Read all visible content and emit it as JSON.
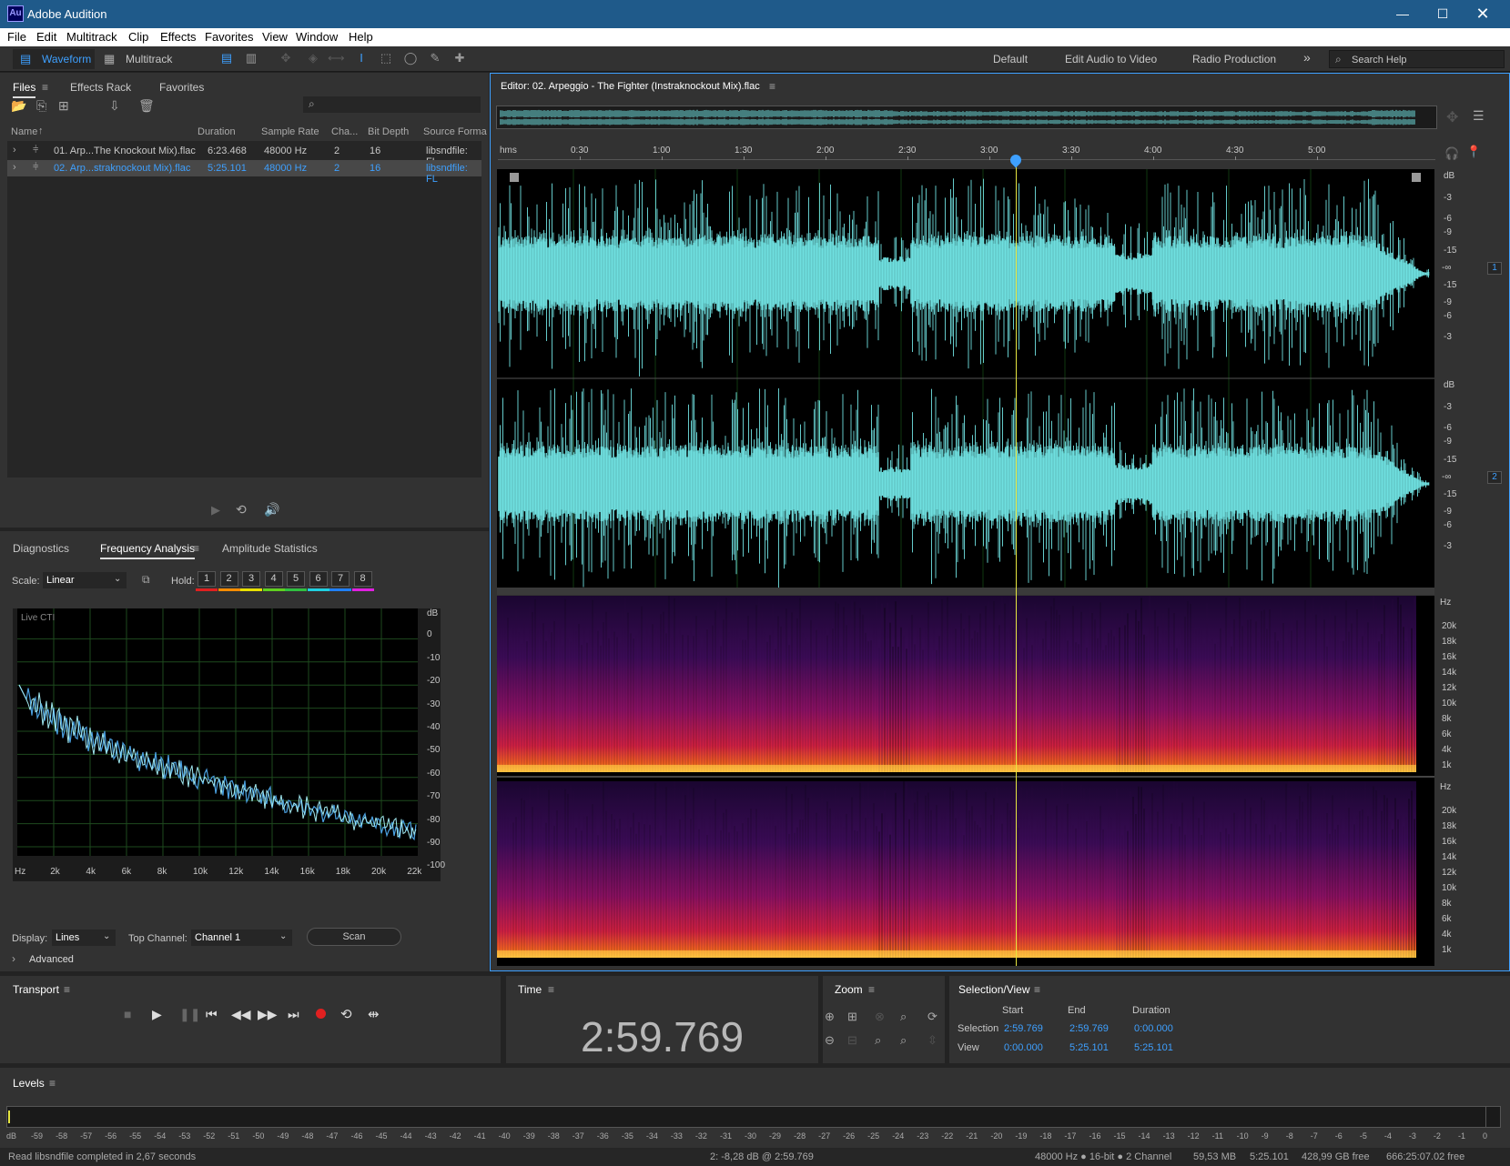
{
  "window": {
    "title": "Adobe Audition",
    "app_icon_text": "Au"
  },
  "menu": [
    "File",
    "Edit",
    "Multitrack",
    "Clip",
    "Effects",
    "Favorites",
    "View",
    "Window",
    "Help"
  ],
  "toolbar": {
    "waveform": "Waveform",
    "multitrack": "Multitrack",
    "workspaces": [
      "Default",
      "Edit Audio to Video",
      "Radio Production"
    ],
    "more": "»",
    "search_placeholder": "Search Help"
  },
  "files_panel": {
    "tabs": [
      "Files",
      "Effects Rack",
      "Favorites"
    ],
    "columns": [
      "Name",
      "Duration",
      "Sample Rate",
      "Cha...",
      "Bit Depth",
      "Source Forma"
    ],
    "rows": [
      {
        "name": "01. Arp...The Knockout Mix).flac",
        "duration": "6:23.468",
        "sample_rate": "48000 Hz",
        "channels": "2",
        "bit_depth": "16",
        "source": "libsndfile: FL"
      },
      {
        "name": "02. Arp...straknockout Mix).flac",
        "duration": "5:25.101",
        "sample_rate": "48000 Hz",
        "channels": "2",
        "bit_depth": "16",
        "source": "libsndfile: FL"
      }
    ]
  },
  "analysis_panel": {
    "tabs": [
      "Diagnostics",
      "Frequency Analysis",
      "Amplitude Statistics"
    ],
    "scale_label": "Scale:",
    "scale_value": "Linear",
    "hold_label": "Hold:",
    "hold_buttons": [
      "1",
      "2",
      "3",
      "4",
      "5",
      "6",
      "7",
      "8"
    ],
    "hold_colors": [
      "#e02020",
      "#ff8c00",
      "#e8e000",
      "#60d020",
      "#30c040",
      "#20d0e0",
      "#2080ff",
      "#e020e0"
    ],
    "graph_label": "Live CTI",
    "db_ticks": [
      "dB",
      "0",
      "-10",
      "-20",
      "-30",
      "-40",
      "-50",
      "-60",
      "-70",
      "-80",
      "-90",
      "-100"
    ],
    "hz_ticks": [
      "Hz",
      "2k",
      "4k",
      "6k",
      "8k",
      "10k",
      "12k",
      "14k",
      "16k",
      "18k",
      "20k",
      "22k"
    ],
    "display_label": "Display:",
    "display_value": "Lines",
    "top_channel_label": "Top Channel:",
    "top_channel_value": "Channel 1",
    "scan": "Scan",
    "advanced": "Advanced"
  },
  "editor": {
    "title": "Editor: 02. Arpeggio - The Fighter (Instraknockout Mix).flac",
    "time_ruler": [
      "hms",
      "0:30",
      "1:00",
      "1:30",
      "2:00",
      "2:30",
      "3:00",
      "3:30",
      "4:00",
      "4:30",
      "5:00"
    ],
    "db_scale_ch": [
      "dB",
      "-3",
      "-6",
      "-9",
      "-15",
      "-∞",
      "-15",
      "-9",
      "-6",
      "-3"
    ],
    "channel_badges": [
      "1",
      "2"
    ],
    "hz_scale": [
      "Hz",
      "20k",
      "18k",
      "16k",
      "14k",
      "12k",
      "10k",
      "8k",
      "6k",
      "4k",
      "1k"
    ],
    "playhead_fraction": 0.553
  },
  "transport": {
    "title": "Transport"
  },
  "time": {
    "title": "Time",
    "value": "2:59.769"
  },
  "zoom": {
    "title": "Zoom"
  },
  "selection_view": {
    "title": "Selection/View",
    "headers": [
      "Start",
      "End",
      "Duration"
    ],
    "selection_label": "Selection",
    "selection": [
      "2:59.769",
      "2:59.769",
      "0:00.000"
    ],
    "view_label": "View",
    "view": [
      "0:00.000",
      "5:25.101",
      "5:25.101"
    ]
  },
  "levels": {
    "title": "Levels",
    "ticks": [
      "dB",
      "-59",
      "-58",
      "-57",
      "-56",
      "-55",
      "-54",
      "-53",
      "-52",
      "-51",
      "-50",
      "-49",
      "-48",
      "-47",
      "-46",
      "-45",
      "-44",
      "-43",
      "-42",
      "-41",
      "-40",
      "-39",
      "-38",
      "-37",
      "-36",
      "-35",
      "-34",
      "-33",
      "-32",
      "-31",
      "-30",
      "-29",
      "-28",
      "-27",
      "-26",
      "-25",
      "-24",
      "-23",
      "-22",
      "-21",
      "-20",
      "-19",
      "-18",
      "-17",
      "-16",
      "-15",
      "-14",
      "-13",
      "-12",
      "-11",
      "-10",
      "-9",
      "-8",
      "-7",
      "-6",
      "-5",
      "-4",
      "-3",
      "-2",
      "-1",
      "0"
    ]
  },
  "status": {
    "left": "Read libsndfile completed in 2,67 seconds",
    "cursor": "2: -8,28 dB @ 2:59.769",
    "format": "48000 Hz ● 16-bit ● 2 Channel",
    "size": "59,53 MB",
    "duration": "5:25.101",
    "free": "428,99 GB free",
    "free_time": "666:25:07.02 free"
  },
  "colors": {
    "waveform": "#6fe0e0",
    "playhead": "#e6e640",
    "accent": "#3ea0ff",
    "record": "#e02020"
  }
}
